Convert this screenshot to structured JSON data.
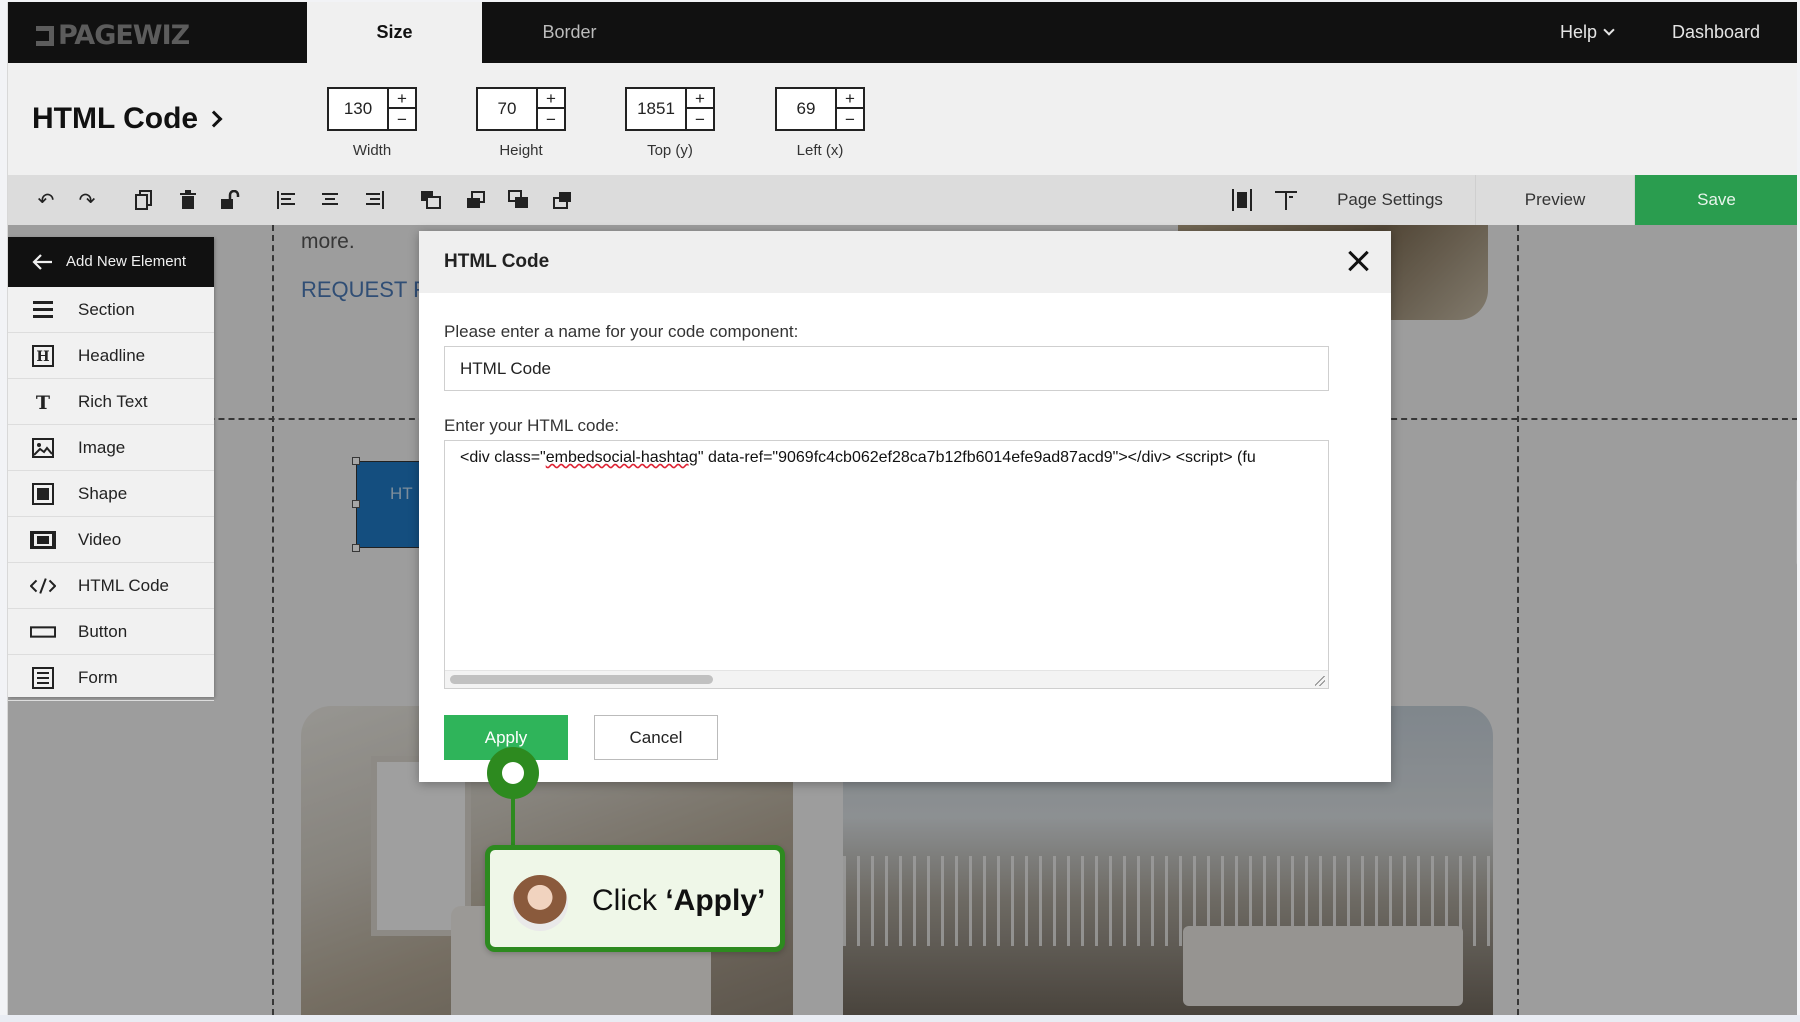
{
  "app": {
    "logo": "PAGEWIZ"
  },
  "topbar": {
    "tabs": [
      {
        "label": "Size",
        "active": true
      },
      {
        "label": "Border",
        "active": false
      }
    ],
    "help": "Help",
    "dashboard": "Dashboard"
  },
  "properties": {
    "element_title": "HTML Code",
    "width": {
      "value": "130",
      "label": "Width"
    },
    "height": {
      "value": "70",
      "label": "Height"
    },
    "top": {
      "value": "1851",
      "label": "Top (y)"
    },
    "left": {
      "value": "69",
      "label": "Left (x)"
    },
    "plus": "+",
    "minus": "−"
  },
  "toolbar": {
    "page_settings": "Page Settings",
    "preview": "Preview",
    "save": "Save"
  },
  "canvas": {
    "text_more": "more.",
    "text_request": "REQUEST FR",
    "selected_element_text": "HT"
  },
  "element_panel": {
    "header": "Add New Element",
    "items": [
      {
        "label": "Section",
        "icon": "section-icon"
      },
      {
        "label": "Headline",
        "icon": "headline-icon"
      },
      {
        "label": "Rich Text",
        "icon": "rich-text-icon"
      },
      {
        "label": "Image",
        "icon": "image-icon"
      },
      {
        "label": "Shape",
        "icon": "shape-icon"
      },
      {
        "label": "Video",
        "icon": "video-icon"
      },
      {
        "label": "HTML Code",
        "icon": "code-icon"
      },
      {
        "label": "Button",
        "icon": "button-icon"
      },
      {
        "label": "Form",
        "icon": "form-icon"
      }
    ]
  },
  "dialog": {
    "title": "HTML Code",
    "name_label": "Please enter a name for your code component:",
    "name_value": "HTML Code",
    "code_label": "Enter your HTML code:",
    "code_before": "<div class=\"",
    "code_misspelled": "embedsocial-hashtag",
    "code_after": "\" data-ref=\"9069fc4cb062ef28ca7b12fb6014efe9ad87acd9\"></div> <script> (fu",
    "apply": "Apply",
    "cancel": "Cancel"
  },
  "guide": {
    "tooltip_prefix": "Click ",
    "tooltip_bold": "‘Apply’"
  },
  "colors": {
    "save_green": "#2a9d4f",
    "apply_green": "#2fb45a",
    "guide_green": "#2d8a1f",
    "topbar": "#111111"
  }
}
